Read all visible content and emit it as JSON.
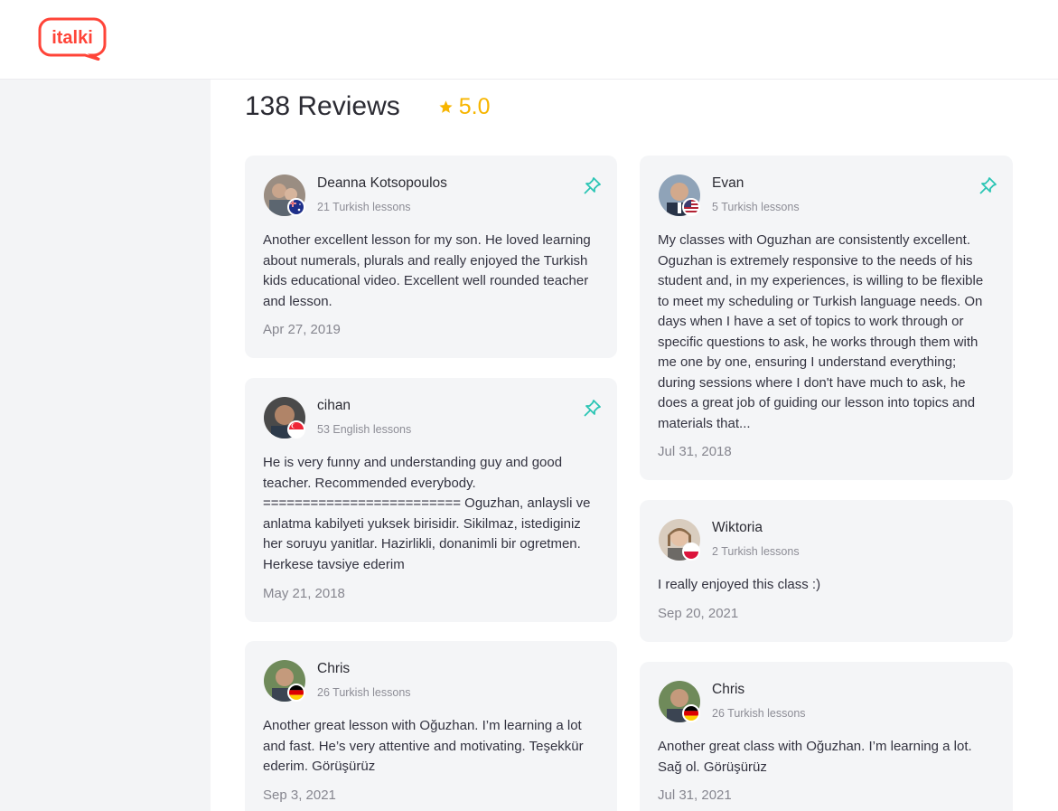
{
  "brand": {
    "logo_text": "italki",
    "color": "#ff4438"
  },
  "reviews_header": {
    "count_label": "138 Reviews",
    "rating": "5.0",
    "star_color": "#f7b500"
  },
  "pin_color": "#2bc5b4",
  "reviews": [
    {
      "name": "Deanna Kotsopoulos",
      "lessons": "21 Turkish lessons",
      "flag": "australia-flag",
      "pinned": true,
      "text": "Another excellent lesson for my son. He loved learning about numerals, plurals and really enjoyed the Turkish kids educational video. Excellent well rounded teacher and lesson.",
      "date": "Apr 27, 2019"
    },
    {
      "name": "cihan",
      "lessons": "53 English lessons",
      "flag": "singapore-flag",
      "pinned": true,
      "text": "He is very funny and understanding guy and good teacher. Recommended everybody. ========================= Oguzhan, anlaysli ve anlatma kabilyeti yuksek birisidir. Sikilmaz, istediginiz her soruyu yanitlar. Hazirlikli, donanimli bir ogretmen. Herkese tavsiye ederim",
      "date": "May 21, 2018"
    },
    {
      "name": "Chris",
      "lessons": "26 Turkish lessons",
      "flag": "germany-flag",
      "pinned": false,
      "text": "Another great lesson with Oğuzhan. I’m learning a lot and fast. He’s very attentive and motivating. Teşekkür ederim. Görüşürüz",
      "date": "Sep 3, 2021"
    },
    {
      "name": "Evan",
      "lessons": "5 Turkish lessons",
      "flag": "usa-flag",
      "pinned": true,
      "text": "My classes with Oguzhan are consistently excellent. Oguzhan is extremely responsive to the needs of his student and, in my experiences, is willing to be flexible to meet my scheduling or Turkish language needs. On days when I have a set of topics to work through or specific questions to ask, he works through them with me one by one, ensuring I understand everything; during sessions where I don't have much to ask, he does a great job of guiding our lesson into topics and materials that...",
      "date": "Jul 31, 2018"
    },
    {
      "name": "Wiktoria",
      "lessons": "2 Turkish lessons",
      "flag": "poland-flag",
      "pinned": false,
      "text": "I really enjoyed this class :)",
      "date": "Sep 20, 2021"
    },
    {
      "name": "Chris",
      "lessons": "26 Turkish lessons",
      "flag": "germany-flag",
      "pinned": false,
      "text": "Another great class with Oğuzhan. I’m learning a lot. Sağ ol. Görüşürüz",
      "date": "Jul 31, 2021"
    }
  ]
}
